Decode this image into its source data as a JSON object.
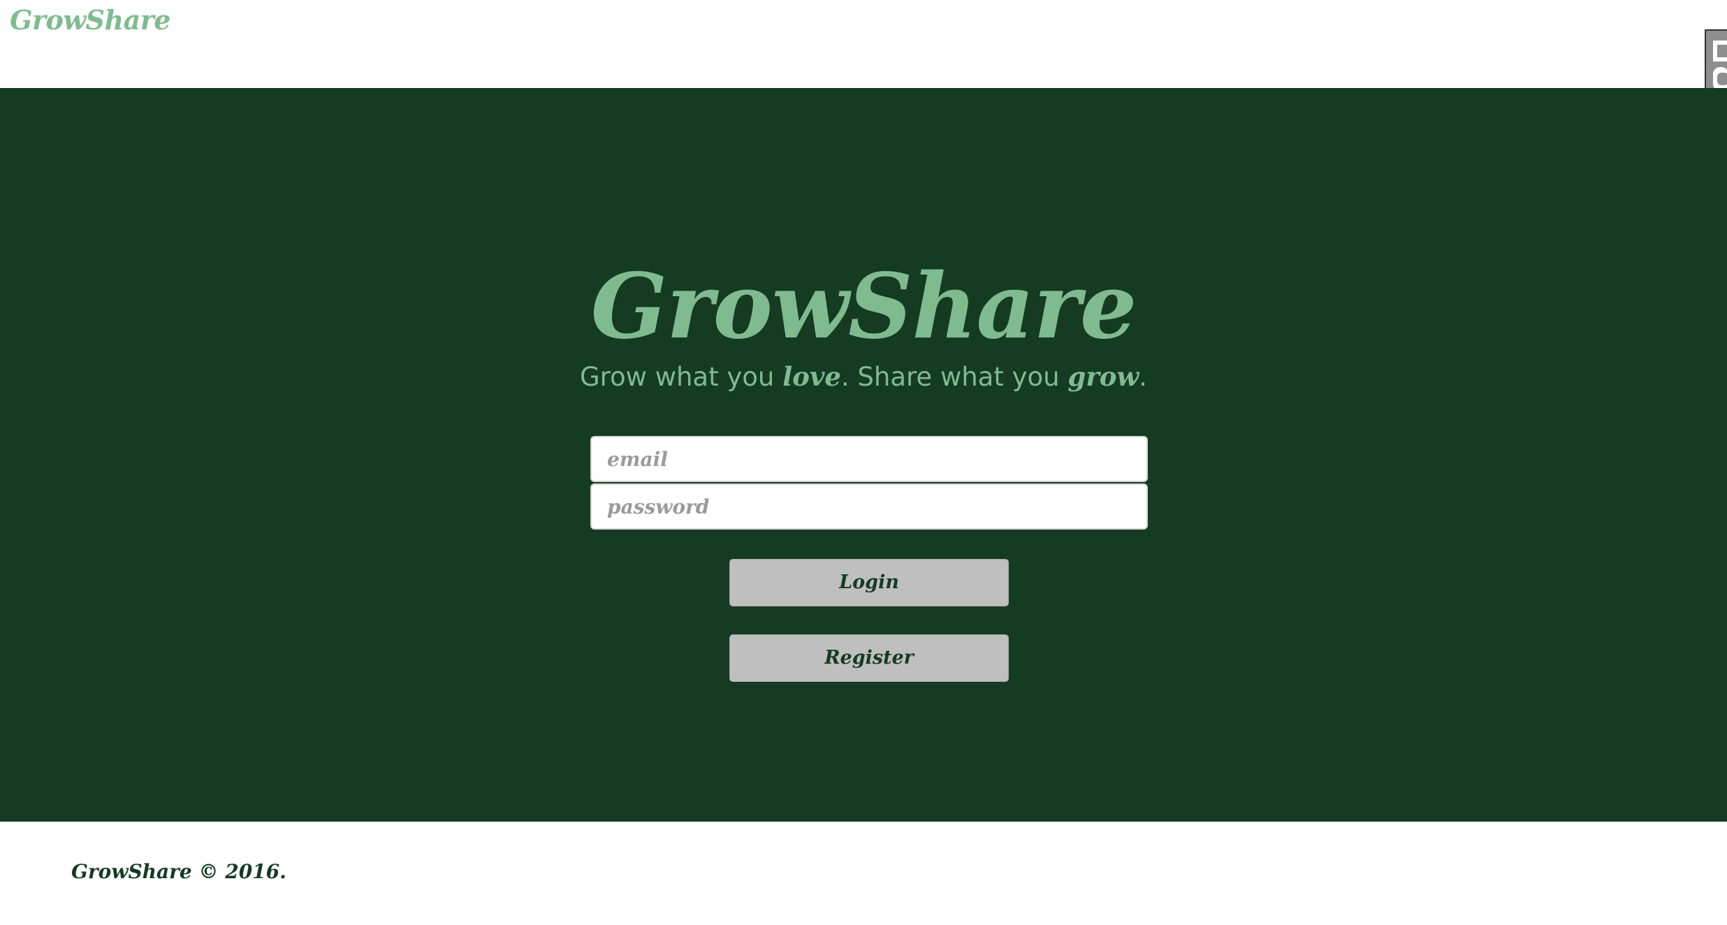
{
  "nav": {
    "brand": "GrowShare"
  },
  "hero": {
    "title": "GrowShare",
    "tagline": {
      "part1": "Grow what you ",
      "emph1": "love",
      "part2": ". Share what you ",
      "emph2": "grow",
      "part3": "."
    }
  },
  "login_form": {
    "email_placeholder": "email",
    "password_placeholder": "password",
    "login_label": "Login",
    "register_label": "Register"
  },
  "footer": {
    "text": "GrowShare © 2016."
  },
  "colors": {
    "hero_background": "#153b23",
    "brand_green": "#7fbb8f",
    "button_grey": "#bfbfbf"
  },
  "icons": {
    "side_widget": "feedback-tab-icon"
  }
}
